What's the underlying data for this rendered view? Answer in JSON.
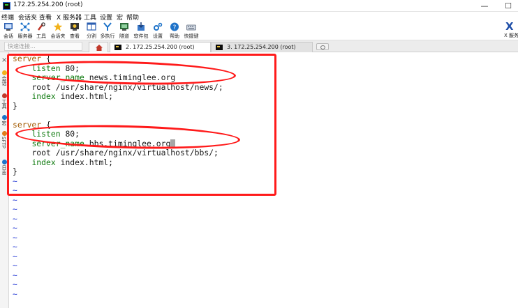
{
  "window": {
    "title": "172.25.254.200 (root)",
    "minimize_glyph": "—",
    "maximize_glyph": "☐"
  },
  "menu": [
    "终端",
    "会话夹",
    "查看",
    "X 服务器",
    "工具",
    "设置",
    "宏",
    "帮助"
  ],
  "toolbar": [
    {
      "label": "会话",
      "icon": "session-icon"
    },
    {
      "label": "服务器",
      "icon": "servers-icon"
    },
    {
      "label": "工具",
      "icon": "tools-icon"
    },
    {
      "label": "会话夹",
      "icon": "star-icon"
    },
    {
      "label": "查看",
      "icon": "view-icon"
    },
    {
      "label": "分割",
      "icon": "split-icon"
    },
    {
      "label": "多执行",
      "icon": "multiexec-icon"
    },
    {
      "label": "隧道",
      "icon": "tunnel-icon"
    },
    {
      "label": "软件包",
      "icon": "packages-icon"
    },
    {
      "label": "设置",
      "icon": "settings-icon"
    },
    {
      "label": "帮助",
      "icon": "help-icon"
    },
    {
      "label": "快捷键",
      "icon": "keyboard-icon"
    }
  ],
  "xserver": {
    "label": "X 服务"
  },
  "quick_connect": {
    "placeholder": "快速连接..."
  },
  "tabs": [
    {
      "label": "2. 172.25.254.200 (root)",
      "active": true
    },
    {
      "label": "3. 172.25.254.200 (root)",
      "active": false
    }
  ],
  "sidebar": {
    "close_glyph": "×",
    "labels": [
      "会话",
      "工具",
      "宏",
      "SFTP",
      "日志"
    ]
  },
  "terminal": {
    "lines": [
      {
        "kw": "server",
        "rest": " {"
      },
      {
        "indent": "    ",
        "dir": "listen",
        "rest": " 80;"
      },
      {
        "indent": "    ",
        "dir": "server_name",
        "rest": " news.timinglee.org"
      },
      {
        "indent": "    ",
        "plain": "root /usr/share/nginx/virtualhost/news/;"
      },
      {
        "indent": "    ",
        "dir": "index",
        "rest": " index.html;"
      },
      {
        "plain": "}"
      },
      {
        "plain": ""
      },
      {
        "kw": "server",
        "rest": " {"
      },
      {
        "indent": "    ",
        "dir": "listen",
        "rest": " 80;"
      },
      {
        "indent": "    ",
        "dir": "server_name",
        "rest": " bbs.timinglee.org",
        "cursor": true
      },
      {
        "indent": "    ",
        "plain": "root /usr/share/nginx/virtualhost/bbs/;"
      },
      {
        "indent": "    ",
        "dir": "index",
        "rest": " index.html;"
      },
      {
        "plain": "}"
      }
    ],
    "tilde": "~",
    "tilde_count": 13
  },
  "annotation_color": "#ff1a1a"
}
